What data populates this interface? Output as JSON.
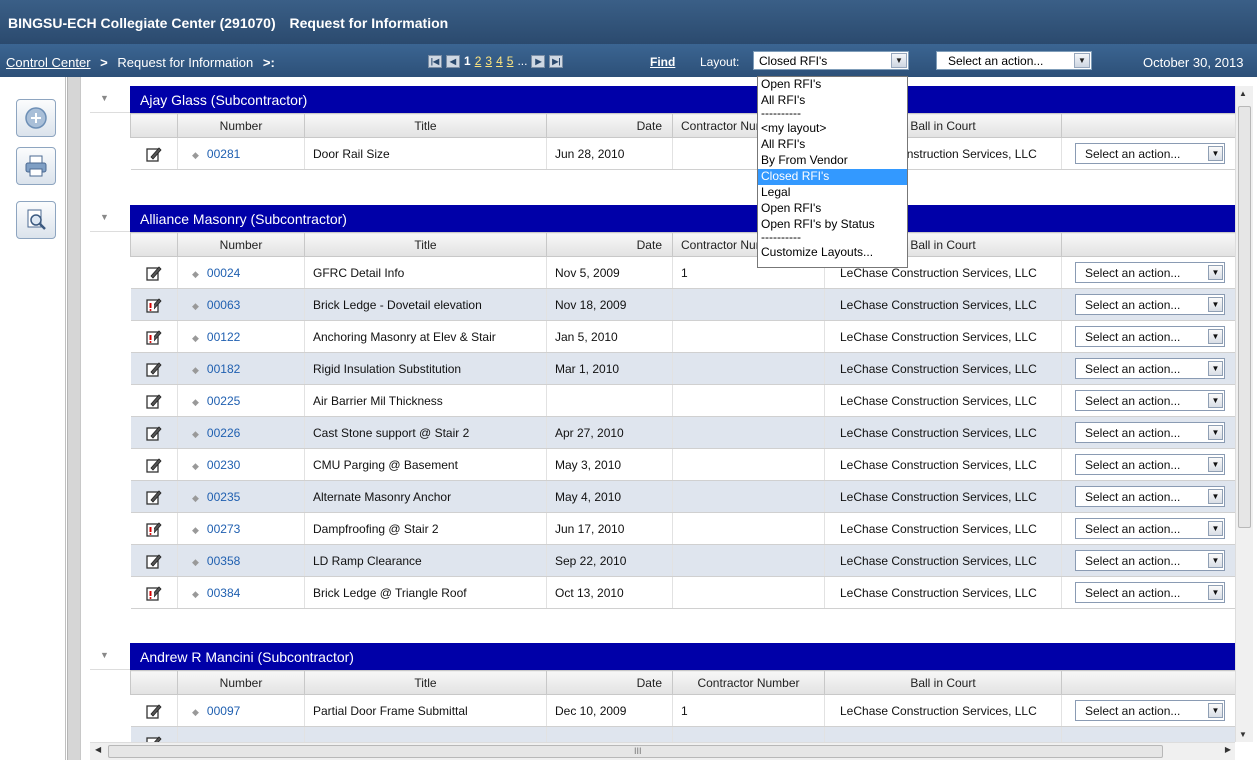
{
  "header": {
    "project": "BINGSU-ECH Collegiate Center (291070)",
    "module": "Request for Information"
  },
  "nav": {
    "breadcrumb_link": "Control Center",
    "breadcrumb_current": "Request for Information",
    "pages": [
      "1",
      "2",
      "3",
      "4",
      "5"
    ],
    "current_page": "1",
    "ellipsis": "...",
    "find": "Find",
    "layout_label": "Layout:",
    "layout_value": "Closed RFI's",
    "action_value": "Select an action...",
    "date": "October 30, 2013"
  },
  "layout_dropdown": {
    "options": [
      "Open RFI's",
      "All RFI's",
      "----------",
      "<my layout>",
      "All RFI's",
      "By From Vendor",
      "Closed RFI's",
      "Legal",
      "Open RFI's",
      "Open RFI's by Status",
      "----------",
      "Customize Layouts..."
    ],
    "selected_index": 6
  },
  "columns": {
    "number": "Number",
    "title": "Title",
    "date": "Date",
    "contractor_number": "Contractor Number",
    "ball_in_court": "Ball in Court"
  },
  "row_action": "Select an action...",
  "groups": [
    {
      "name": "Ajay Glass (Subcontractor)",
      "rows": [
        {
          "icon": "edit",
          "number": "00281",
          "title": "Door Rail Size",
          "date": "Jun 28, 2010",
          "contractor": "",
          "ball": "LeChase Construction Services, LLC"
        }
      ]
    },
    {
      "name": "Alliance Masonry (Subcontractor)",
      "rows": [
        {
          "icon": "edit",
          "number": "00024",
          "title": "GFRC Detail Info",
          "date": "Nov 5, 2009",
          "contractor": "1",
          "ball": "LeChase Construction Services, LLC"
        },
        {
          "icon": "urgent",
          "number": "00063",
          "title": "Brick Ledge - Dovetail elevation",
          "date": "Nov 18, 2009",
          "contractor": "",
          "ball": "LeChase Construction Services, LLC"
        },
        {
          "icon": "urgent",
          "number": "00122",
          "title": "Anchoring Masonry at Elev & Stair",
          "date": "Jan 5, 2010",
          "contractor": "",
          "ball": "LeChase Construction Services, LLC"
        },
        {
          "icon": "edit",
          "number": "00182",
          "title": "Rigid Insulation Substitution",
          "date": "Mar 1, 2010",
          "contractor": "",
          "ball": "LeChase Construction Services, LLC"
        },
        {
          "icon": "edit",
          "number": "00225",
          "title": "Air Barrier Mil Thickness",
          "date": "",
          "contractor": "",
          "ball": "LeChase Construction Services, LLC"
        },
        {
          "icon": "edit",
          "number": "00226",
          "title": "Cast Stone support @ Stair 2",
          "date": "Apr 27, 2010",
          "contractor": "",
          "ball": "LeChase Construction Services, LLC"
        },
        {
          "icon": "edit",
          "number": "00230",
          "title": "CMU Parging @ Basement",
          "date": "May 3, 2010",
          "contractor": "",
          "ball": "LeChase Construction Services, LLC"
        },
        {
          "icon": "edit",
          "number": "00235",
          "title": "Alternate Masonry Anchor",
          "date": "May 4, 2010",
          "contractor": "",
          "ball": "LeChase Construction Services, LLC"
        },
        {
          "icon": "urgent",
          "number": "00273",
          "title": "Dampfroofing @ Stair 2",
          "date": "Jun 17, 2010",
          "contractor": "",
          "ball": "LeChase Construction Services, LLC"
        },
        {
          "icon": "edit",
          "number": "00358",
          "title": "LD Ramp Clearance",
          "date": "Sep 22, 2010",
          "contractor": "",
          "ball": "LeChase Construction Services, LLC"
        },
        {
          "icon": "urgent",
          "number": "00384",
          "title": "Brick Ledge @ Triangle Roof",
          "date": "Oct 13, 2010",
          "contractor": "",
          "ball": "LeChase Construction Services, LLC"
        }
      ]
    },
    {
      "name": "Andrew R Mancini (Subcontractor)",
      "rows": [
        {
          "icon": "edit",
          "number": "00097",
          "title": "Partial Door Frame Submittal",
          "date": "Dec 10, 2009",
          "contractor": "1",
          "ball": "LeChase Construction Services, LLC"
        },
        {
          "icon": "edit",
          "number": "",
          "title": "",
          "date": "",
          "contractor": "",
          "ball": ""
        }
      ]
    }
  ],
  "hscroll_mark": "III"
}
